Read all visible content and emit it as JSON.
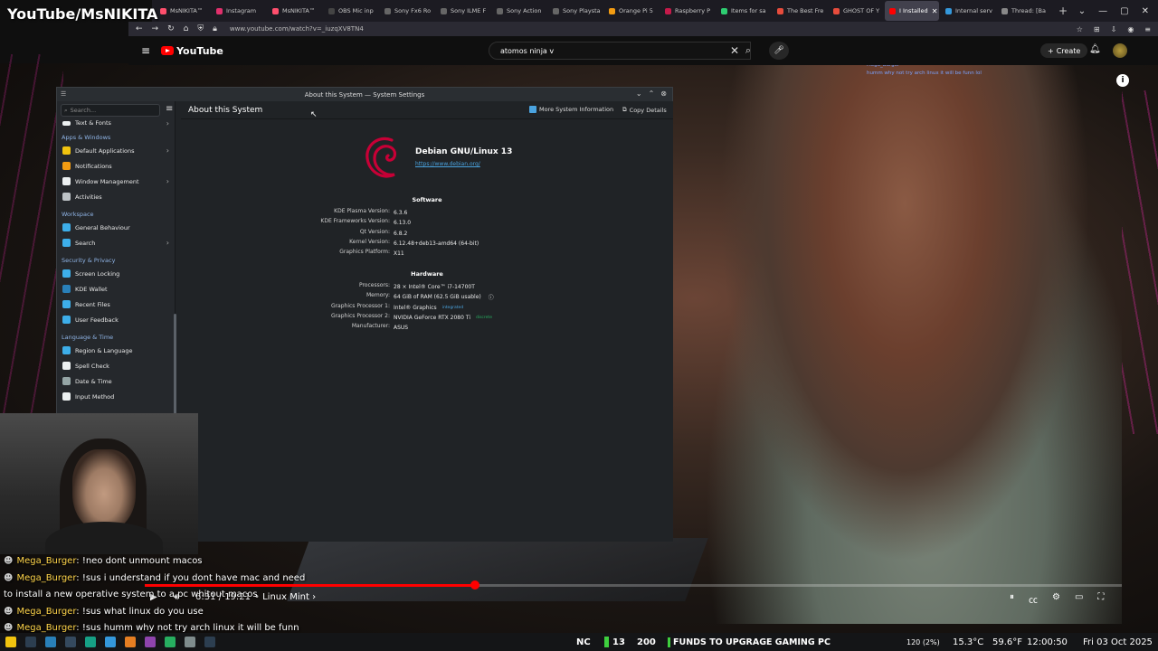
{
  "stream": {
    "label": "YouTube/MsNIKITA"
  },
  "browser": {
    "tabs": [
      {
        "label": "MsNIKITA™",
        "color": "#ff4f6d"
      },
      {
        "label": "Instagram",
        "color": "#e1306c"
      },
      {
        "label": "MsNIKITA™",
        "color": "#ff4f6d"
      },
      {
        "label": "OBS Mic inp",
        "color": "#444"
      },
      {
        "label": "Sony Fx6 Ro",
        "color": "#666"
      },
      {
        "label": "Sony ILME F",
        "color": "#666"
      },
      {
        "label": "Sony Action",
        "color": "#666"
      },
      {
        "label": "Sony Playsta",
        "color": "#666"
      },
      {
        "label": "Orange Pi 5",
        "color": "#f39c12"
      },
      {
        "label": "Raspberry P",
        "color": "#c51a4a"
      },
      {
        "label": "Items for sa",
        "color": "#2ecc71"
      },
      {
        "label": "The Best Fre",
        "color": "#e74c3c"
      },
      {
        "label": "GHOST OF Y",
        "color": "#e74c3c"
      },
      {
        "label": "I Installed",
        "color": "#ff0000",
        "active": true
      },
      {
        "label": "Internal serv",
        "color": "#3498db"
      },
      {
        "label": "Thread: [Ba",
        "color": "#888"
      }
    ],
    "url": "www.youtube.com/watch?v=_iuzqXV8TN4",
    "tab_close": "✕",
    "tab_new": "+"
  },
  "youtube": {
    "logo_text": "YouTube",
    "search_value": "atomos ninja v",
    "create_label": "Create",
    "top_chat_user": "Mega_Burger",
    "top_chat_msg": "humm why not try arch linux it will be funn lol"
  },
  "kde": {
    "window_title": "About this System — System Settings",
    "search_placeholder": "Search...",
    "sidebar": {
      "first_item": "Text & Fonts",
      "categories": [
        {
          "title": "Apps & Windows",
          "items": [
            {
              "label": "Default Applications",
              "icon": "star-icon",
              "color": "#f1c40f",
              "arrow": true
            },
            {
              "label": "Notifications",
              "icon": "bell-icon",
              "color": "#f39c12"
            },
            {
              "label": "Window Management",
              "icon": "window-icon",
              "color": "#ecf0f1",
              "arrow": true
            },
            {
              "label": "Activities",
              "icon": "activities-icon",
              "color": "#bdc3c7"
            }
          ]
        },
        {
          "title": "Workspace",
          "items": [
            {
              "label": "General Behaviour",
              "icon": "behaviour-icon",
              "color": "#3daee9"
            },
            {
              "label": "Search",
              "icon": "search-icon",
              "color": "#3daee9",
              "arrow": true
            }
          ]
        },
        {
          "title": "Security & Privacy",
          "items": [
            {
              "label": "Screen Locking",
              "icon": "lock-icon",
              "color": "#3daee9"
            },
            {
              "label": "KDE Wallet",
              "icon": "wallet-icon",
              "color": "#2980b9"
            },
            {
              "label": "Recent Files",
              "icon": "recent-files-icon",
              "color": "#3daee9"
            },
            {
              "label": "User Feedback",
              "icon": "feedback-icon",
              "color": "#3daee9"
            }
          ]
        },
        {
          "title": "Language & Time",
          "items": [
            {
              "label": "Region & Language",
              "icon": "region-icon",
              "color": "#3daee9"
            },
            {
              "label": "Spell Check",
              "icon": "spellcheck-icon",
              "color": "#ecf0f1"
            },
            {
              "label": "Date & Time",
              "icon": "clock-icon",
              "color": "#95a5a6"
            },
            {
              "label": "Input Method",
              "icon": "input-method-icon",
              "color": "#ecf0f1"
            }
          ]
        }
      ]
    },
    "page_title": "About this System",
    "more_info_label": "More System Information",
    "copy_details_label": "Copy Details",
    "distro_name": "Debian GNU/Linux 13",
    "distro_url": "https://www.debian.org/",
    "software_title": "Software",
    "software": [
      {
        "k": "KDE Plasma Version:",
        "v": "6.3.6"
      },
      {
        "k": "KDE Frameworks Version:",
        "v": "6.13.0"
      },
      {
        "k": "Qt Version:",
        "v": "6.8.2"
      },
      {
        "k": "Kernel Version:",
        "v": "6.12.48+deb13-amd64 (64-bit)"
      },
      {
        "k": "Graphics Platform:",
        "v": "X11"
      }
    ],
    "hardware_title": "Hardware",
    "hardware": [
      {
        "k": "Processors:",
        "v": "28 × Intel® Core™ i7-14700T"
      },
      {
        "k": "Memory:",
        "v": "64 GiB of RAM (62.5 GiB usable)",
        "info": true
      },
      {
        "k": "Graphics Processor 1:",
        "v": "Intel® Graphics",
        "tag": "integrated",
        "tagclass": "int"
      },
      {
        "k": "Graphics Processor 2:",
        "v": "NVIDIA GeForce RTX 2080 Ti",
        "tag": "discrete",
        "tagclass": "dis"
      },
      {
        "k": "Manufacturer:",
        "v": "ASUS"
      }
    ]
  },
  "chat": [
    {
      "user": "Mega_Burger",
      "msg": ": !neo dont unmount macos"
    },
    {
      "user": "Mega_Burger",
      "msg": ": !sus i understand if you dont have mac and need"
    },
    {
      "user": "",
      "msg": "to install a new operative system to a pc whitout macos"
    },
    {
      "user": "Mega_Burger",
      "msg": ": !sus what linux do you use"
    },
    {
      "user": "Mega_Burger",
      "msg": ": !sus humm why not try arch linux it will be funn"
    }
  ],
  "player": {
    "time": "6:31 / 19:21",
    "chapter": "• Linux Mint ›",
    "progress_fraction": 0.338
  },
  "taskbar": {
    "nc": "NC",
    "count1": "13",
    "count2": "200",
    "goal": "FUNDS TO UPGRAGE GAMING PC",
    "cpu": "120 (2%)",
    "temp_c": "15.3°C",
    "temp_f": "59.6°F",
    "clock": "12:00:50",
    "date": "Fri 03 Oct 2025"
  }
}
